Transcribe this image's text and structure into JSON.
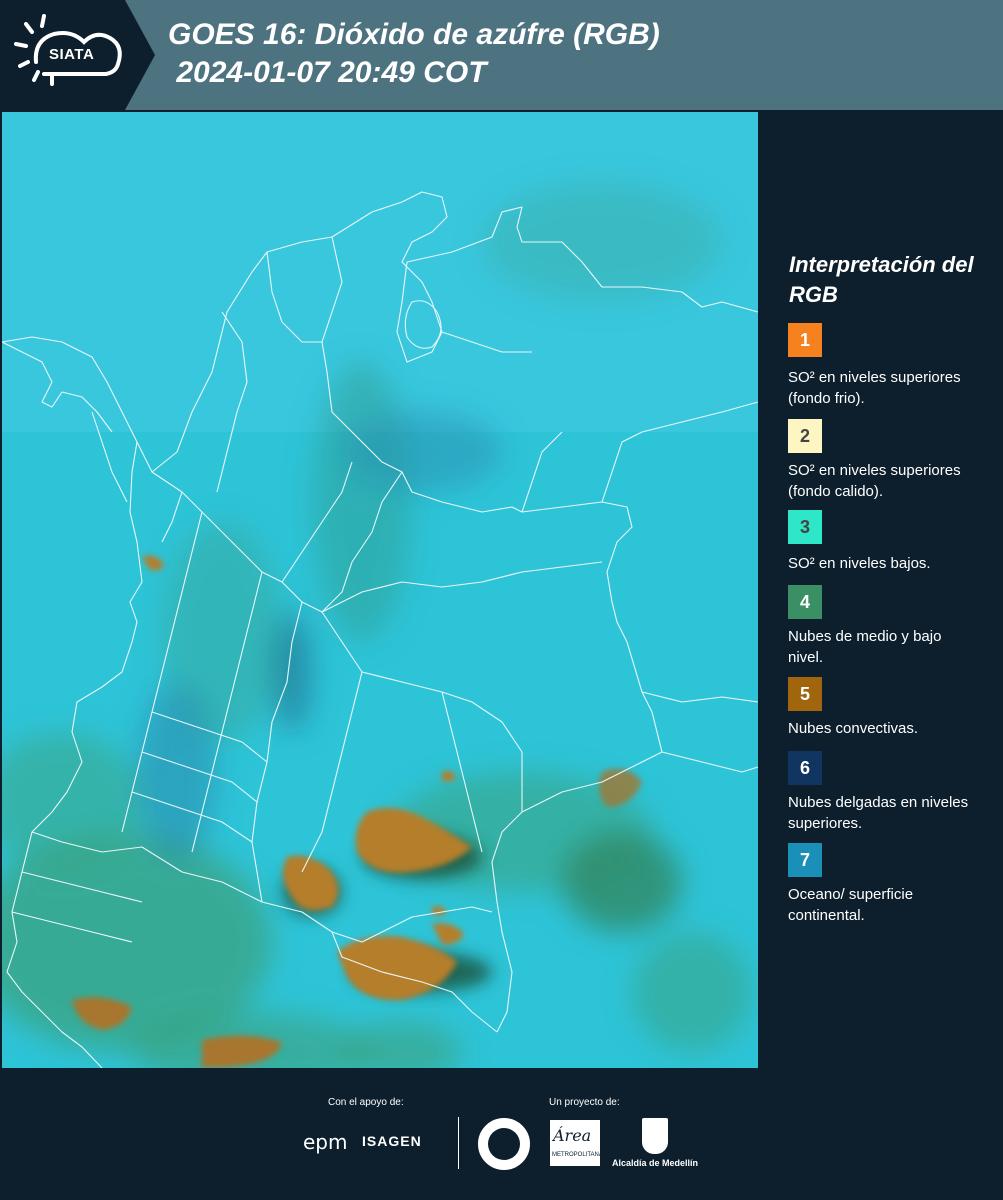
{
  "header": {
    "logo_text": "SIATA",
    "title": "GOES 16: Dióxido de azúfre (RGB)\n 2024-01-07 20:49 COT"
  },
  "legend": {
    "title": "Interpretación del RGB",
    "items": [
      {
        "number": "1",
        "color": "#f5821f",
        "label": "SO² en niveles superiores (fondo frio)."
      },
      {
        "number": "2",
        "color": "#fdf6c3",
        "label": "SO² en niveles superiores (fondo calido)."
      },
      {
        "number": "3",
        "color": "#2ee6c8",
        "label": "SO² en niveles bajos."
      },
      {
        "number": "4",
        "color": "#3a8f64",
        "label": "Nubes de medio y bajo nivel."
      },
      {
        "number": "5",
        "color": "#a0650d",
        "label": "Nubes convectivas."
      },
      {
        "number": "6",
        "color": "#0f3560",
        "label": "Nubes delgadas en niveles superiores."
      },
      {
        "number": "7",
        "color": "#1a8fb8",
        "label": "Oceano/ superficie continental."
      }
    ]
  },
  "map": {
    "background_color": "#2fc4d6",
    "border_color": "#e8f6f8"
  },
  "footer": {
    "support_label": "Con el apoyo de:",
    "project_label": "Un proyecto de:",
    "sponsor_1": "epm",
    "sponsor_2": "ISAGEN",
    "area_logo": "Área",
    "area_sub": "METROPOLITANA",
    "alcaldia": "Alcaldía de Medellín"
  }
}
